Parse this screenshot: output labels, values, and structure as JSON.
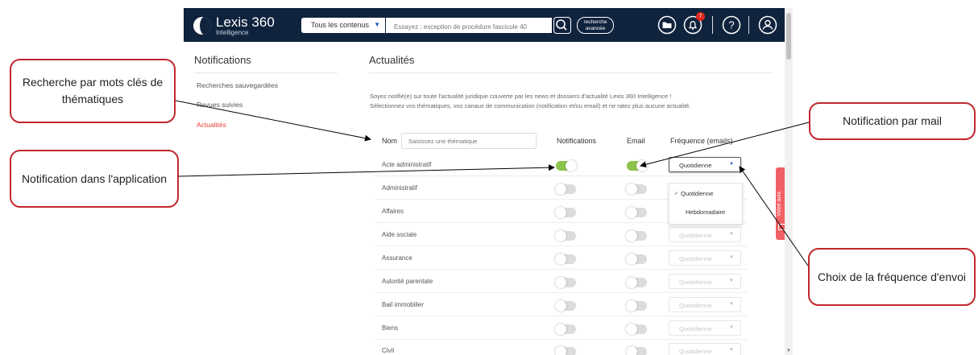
{
  "topbar": {
    "logo_name": "Lexis 360",
    "logo_sub": "Intelligence",
    "scope_label": "Tous les contenus",
    "search_placeholder": "Essayez : exception de procédure fascicule 40",
    "advanced_search_label": "recherche avancée",
    "notification_count": "7"
  },
  "sidebar": {
    "title": "Notifications",
    "items": [
      {
        "label": "Recherches sauvegardées",
        "active": false
      },
      {
        "label": "Revues suivies",
        "active": false
      },
      {
        "label": "Actualités",
        "active": true
      }
    ]
  },
  "main": {
    "title": "Actualités",
    "intro_line1": "Soyez notifié(e) sur toute l'actualité juridique couverte par les news et dossiers d'actualité Lexis 360 Intelligence !",
    "intro_line2": "Sélectionnez vos thématiques, vos canaux de communication (notification et/ou email) et ne ratez plus aucune actualité.",
    "nom_label": "Nom",
    "nom_placeholder": "Saisissez une thématique",
    "col_notifications": "Notifications",
    "col_email": "Email",
    "col_frequency": "Fréquence (emails)",
    "rows": [
      {
        "label": "Acte administratif",
        "notif_on": true,
        "email_on": true,
        "freq": "Quotidienne"
      },
      {
        "label": "Administratif",
        "notif_on": false,
        "email_on": false,
        "freq": ""
      },
      {
        "label": "Affaires",
        "notif_on": false,
        "email_on": false,
        "freq": ""
      },
      {
        "label": "Aide sociale",
        "notif_on": false,
        "email_on": false,
        "freq": "Quotidienne"
      },
      {
        "label": "Assurance",
        "notif_on": false,
        "email_on": false,
        "freq": "Quotidienne"
      },
      {
        "label": "Autorité parentale",
        "notif_on": false,
        "email_on": false,
        "freq": "Quotidienne"
      },
      {
        "label": "Bail immobilier",
        "notif_on": false,
        "email_on": false,
        "freq": "Quotidienne"
      },
      {
        "label": "Biens",
        "notif_on": false,
        "email_on": false,
        "freq": "Quotidienne"
      },
      {
        "label": "Civil",
        "notif_on": false,
        "email_on": false,
        "freq": "Quotidienne"
      }
    ],
    "frequency_options": [
      "Quotidienne",
      "Hebdomadaire"
    ]
  },
  "feedback_label": "Votre avis",
  "callouts": {
    "keywords": "Recherche par mots clés de thématiques",
    "in_app": "Notification dans l'application",
    "by_mail": "Notification par mail",
    "frequency": "Choix de la fréquence d'envoi"
  },
  "colors": {
    "topbar": "#10233d",
    "accent_red": "#e8413b",
    "toggle_on": "#8cc34a",
    "callout_border": "#c1272d"
  },
  "icons": [
    "folder-icon",
    "bell-icon",
    "help-icon",
    "user-icon",
    "search-icon",
    "chevron-down-icon",
    "check-icon",
    "mail-icon"
  ]
}
